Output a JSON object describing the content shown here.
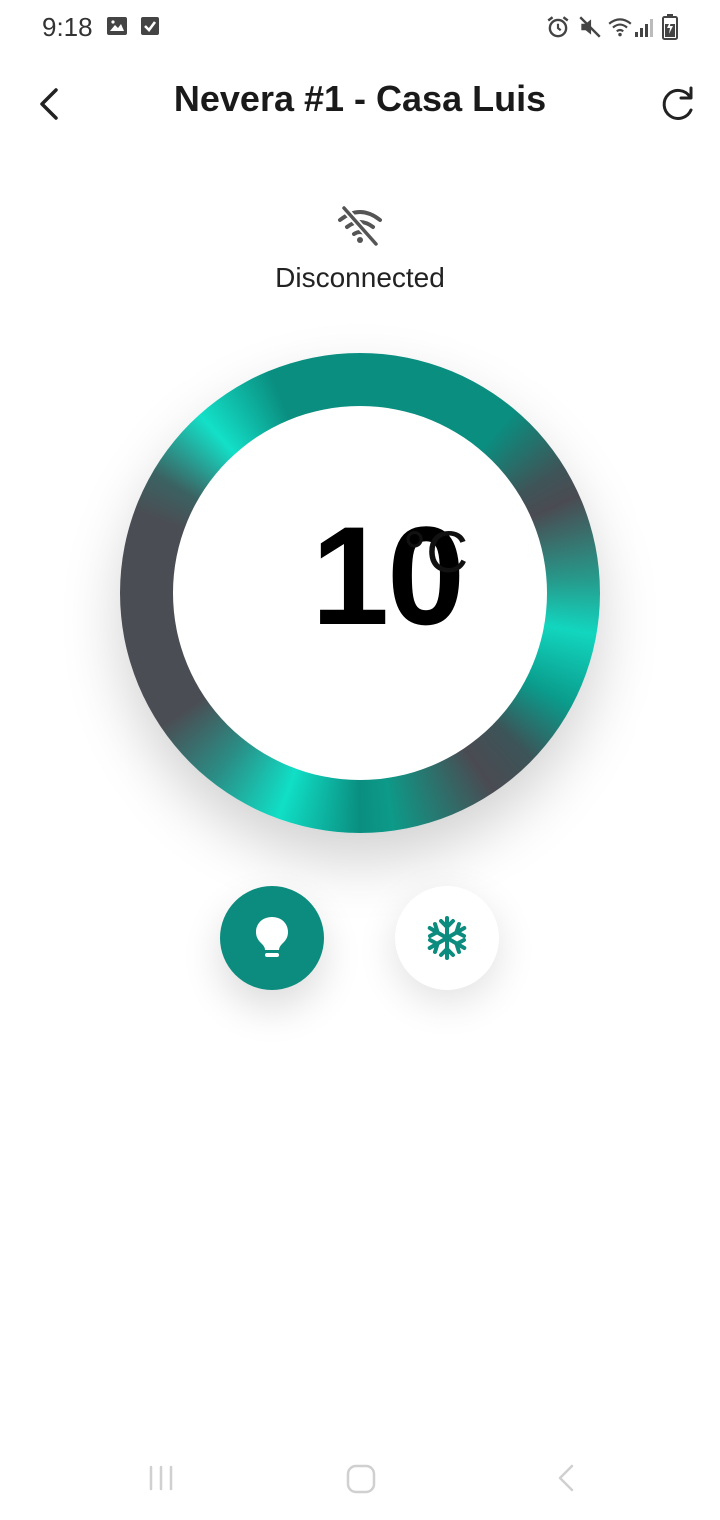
{
  "status_bar": {
    "time": "9:18",
    "left_icons": [
      "image-icon",
      "checkbox-icon"
    ],
    "right_icons": [
      "alarm-icon",
      "mute-icon",
      "wifi-icon",
      "signal-icon",
      "battery-icon"
    ]
  },
  "header": {
    "title": "Nevera #1 - Casa Luis",
    "back_icon": "chevron-left-icon",
    "refresh_icon": "refresh-icon"
  },
  "connection": {
    "status": "Disconnected",
    "icon": "wifi-off-icon"
  },
  "thermostat": {
    "value": "10",
    "unit": "°C"
  },
  "actions": [
    {
      "name": "light",
      "icon": "lightbulb-icon",
      "active": true
    },
    {
      "name": "freeze",
      "icon": "snowflake-icon",
      "active": false
    }
  ],
  "colors": {
    "accent": "#0c8c7e",
    "ring_highlight": "#12d6bf",
    "ring_dark": "#4a4b52"
  },
  "nav_bar": {
    "icons": [
      "recents-icon",
      "home-icon",
      "back-icon"
    ]
  }
}
